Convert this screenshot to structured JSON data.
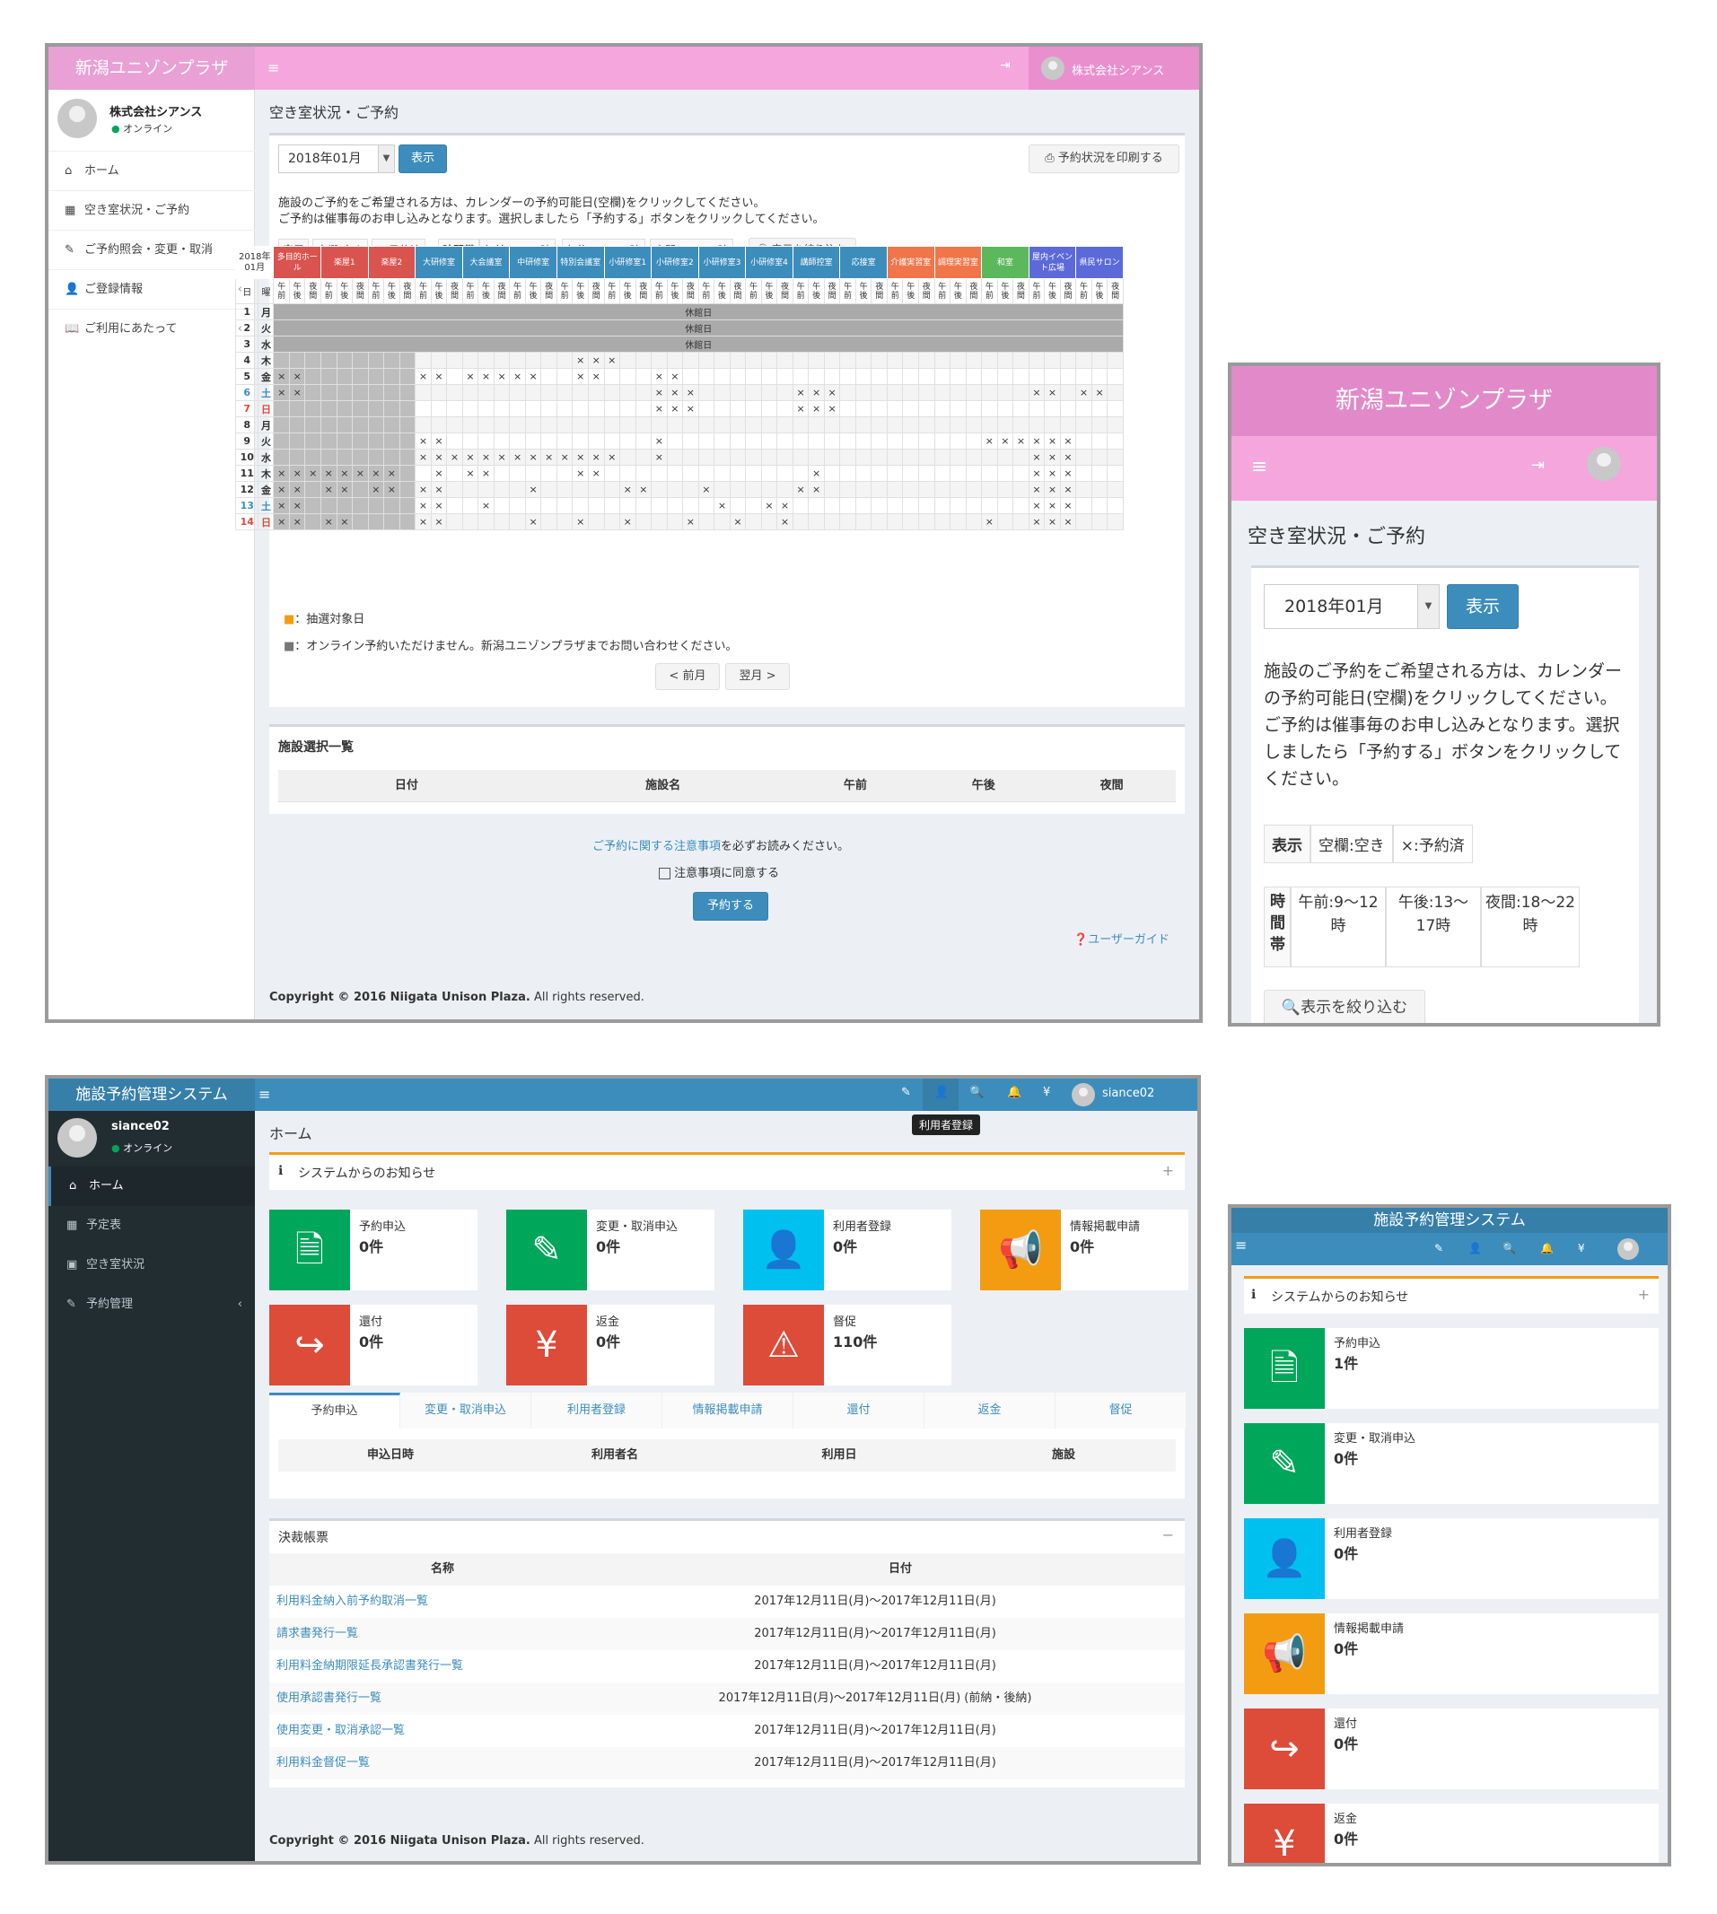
{
  "p1": {
    "logo": "新潟ユニゾンプラザ",
    "user": "株式会社シアンス",
    "status": "オンライン",
    "nav": [
      {
        "icon": "home-icon",
        "label": "ホーム"
      },
      {
        "icon": "calendar-icon",
        "label": "空き室状況・ご予約"
      },
      {
        "icon": "pencil-icon",
        "label": "ご予約照会・変更・取消"
      },
      {
        "icon": "user-icon",
        "label": "ご登録情報"
      },
      {
        "icon": "book-icon",
        "label": "ご利用にあたって"
      }
    ],
    "page_title": "空き室状況・ご予約",
    "month": "2018年01月",
    "show_btn": "表示",
    "print_btn": "予約状況を印刷する",
    "info1": "施設のご予約をご希望される方は、カレンダーの予約可能日(空欄)をクリックしてください。",
    "info2": "ご予約は催事毎のお申し込みとなります。選択しましたら「予約する」ボタンをクリックしてください。",
    "legend": {
      "show": "表示",
      "empty": "空欄:空き",
      "booked": "×:予約済",
      "time": "時間帯",
      "am": "午前:9〜12時",
      "pm": "午後:13〜17時",
      "night": "夜間:18〜22時",
      "filter": "表示を絞り込む"
    },
    "cal_corner": "2018年01月",
    "day_hdr": "日",
    "dow_hdr": "曜",
    "rooms": [
      {
        "name": "多目的ホール",
        "color": "#d9534f"
      },
      {
        "name": "楽屋1",
        "color": "#d9534f"
      },
      {
        "name": "楽屋2",
        "color": "#d9534f"
      },
      {
        "name": "大研修室",
        "color": "#3c8dbc"
      },
      {
        "name": "大会議室",
        "color": "#3c8dbc"
      },
      {
        "name": "中研修室",
        "color": "#3c8dbc"
      },
      {
        "name": "特別会議室",
        "color": "#3c8dbc"
      },
      {
        "name": "小研修室1",
        "color": "#3c8dbc"
      },
      {
        "name": "小研修室2",
        "color": "#3c8dbc"
      },
      {
        "name": "小研修室3",
        "color": "#3c8dbc"
      },
      {
        "name": "小研修室4",
        "color": "#3c8dbc"
      },
      {
        "name": "講師控室",
        "color": "#3c8dbc"
      },
      {
        "name": "応接室",
        "color": "#3c8dbc"
      },
      {
        "name": "介護実習室",
        "color": "#f0764a"
      },
      {
        "name": "調理実習室",
        "color": "#f0764a"
      },
      {
        "name": "和室",
        "color": "#5cb85c"
      },
      {
        "name": "屋内イベント広場",
        "color": "#5b6ad8"
      },
      {
        "name": "県民サロン",
        "color": "#5b6ad8"
      }
    ],
    "slots": [
      "午前",
      "午後",
      "夜間"
    ],
    "days": [
      {
        "d": "1",
        "w": "月",
        "closed": "休館日"
      },
      {
        "d": "2",
        "w": "火",
        "closed": "休館日"
      },
      {
        "d": "3",
        "w": "水",
        "closed": "休館日"
      },
      {
        "d": "4",
        "w": "木",
        "x": [
          19,
          20,
          21
        ]
      },
      {
        "d": "5",
        "w": "金",
        "x": [
          0,
          1,
          9,
          10,
          12,
          13,
          14,
          15,
          16,
          19,
          20,
          24,
          25
        ]
      },
      {
        "d": "6",
        "w": "土",
        "x": [
          0,
          1,
          24,
          25,
          26,
          33,
          34,
          35,
          48,
          49,
          51,
          52
        ],
        "c": "#3c8dbc"
      },
      {
        "d": "7",
        "w": "日",
        "x": [
          24,
          25,
          26,
          33,
          34,
          35
        ],
        "c": "#dd4b39"
      },
      {
        "d": "8",
        "w": "月",
        "x": []
      },
      {
        "d": "9",
        "w": "火",
        "x": [
          9,
          10,
          24,
          45,
          46,
          47,
          48,
          49,
          50
        ]
      },
      {
        "d": "10",
        "w": "水",
        "x": [
          9,
          10,
          11,
          12,
          13,
          14,
          15,
          16,
          17,
          18,
          19,
          20,
          21,
          24,
          48,
          49,
          50
        ]
      },
      {
        "d": "11",
        "w": "木",
        "x": [
          0,
          1,
          2,
          3,
          4,
          5,
          6,
          7,
          10,
          12,
          13,
          19,
          20,
          34,
          48,
          49,
          50
        ]
      },
      {
        "d": "12",
        "w": "金",
        "x": [
          0,
          1,
          3,
          4,
          6,
          7,
          9,
          10,
          16,
          22,
          23,
          27,
          33,
          34,
          48,
          49,
          50
        ]
      },
      {
        "d": "13",
        "w": "土",
        "x": [
          0,
          1,
          9,
          10,
          13,
          28,
          31,
          32,
          48,
          49,
          50
        ],
        "c": "#3c8dbc"
      },
      {
        "d": "14",
        "w": "日",
        "x": [
          0,
          1,
          3,
          4,
          9,
          10,
          16,
          19,
          22,
          26,
          29,
          32,
          45,
          48,
          49,
          50
        ],
        "c": "#dd4b39"
      }
    ],
    "note1": "：抽選対象日",
    "note2": "：オンライン予約いただけません。新潟ユニゾンプラザまでお問い合わせください。",
    "prev": "< 前月",
    "next": "翌月 >",
    "sel_title": "施設選択一覧",
    "sel_cols": [
      "日付",
      "施設名",
      "午前",
      "午後",
      "夜間"
    ],
    "notice_link": "ご予約に関する注意事項",
    "notice_rest": "を必ずお読みください。",
    "agree": "注意事項に同意する",
    "reserve": "予約する",
    "guide": "ユーザーガイド",
    "copyright_b": "Copyright © 2016 Niigata Unison Plaza.",
    "copyright": "All rights reserved."
  },
  "p2": {
    "logo": "新潟ユニゾンプラザ",
    "title": "空き室状況・ご予約",
    "month": "2018年01月",
    "show": "表示",
    "info": "施設のご予約をご希望される方は、カレンダーの予約可能日(空欄)をクリックしてください。ご予約は催事毎のお申し込みとなります。選択しましたら「予約する」ボタンをクリックしてください。",
    "lg_show": "表示",
    "lg_empty": "空欄:空き",
    "lg_booked": "×:予約済",
    "time": "時間帯",
    "am": "午前:9〜12時",
    "pm": "午後:13〜17時",
    "night": "夜間:18〜22時",
    "filter": "表示を絞り込む"
  },
  "p3": {
    "logo": "施設予約管理システム",
    "user": "siance02",
    "status": "オンライン",
    "tooltip": "利用者登録",
    "nav": [
      {
        "icon": "home-icon",
        "label": "ホーム"
      },
      {
        "icon": "table-icon",
        "label": "予定表"
      },
      {
        "icon": "calendar-icon",
        "label": "空き室状況"
      },
      {
        "icon": "pencil-icon",
        "label": "予約管理"
      }
    ],
    "page_title": "ホーム",
    "notice": "システムからのお知らせ",
    "boxes": [
      {
        "label": "予約申込",
        "count": "0件",
        "color": "#00a65a",
        "icon": "document-icon",
        "glyph": "🗎"
      },
      {
        "label": "変更・取消申込",
        "count": "0件",
        "color": "#00a65a",
        "icon": "edit-icon",
        "glyph": "✎"
      },
      {
        "label": "利用者登録",
        "count": "0件",
        "color": "#00c0ef",
        "icon": "user-icon",
        "glyph": "👤"
      },
      {
        "label": "情報掲載申請",
        "count": "0件",
        "color": "#f39c12",
        "icon": "megaphone-icon",
        "glyph": "📢"
      },
      {
        "label": "還付",
        "count": "0件",
        "color": "#dd4b39",
        "icon": "share-icon",
        "glyph": "↪"
      },
      {
        "label": "返金",
        "count": "0件",
        "color": "#dd4b39",
        "icon": "yen-icon",
        "glyph": "¥"
      },
      {
        "label": "督促",
        "count": "110件",
        "color": "#dd4b39",
        "icon": "warning-icon",
        "glyph": "⚠"
      }
    ],
    "tabs": [
      "予約申込",
      "変更・取消申込",
      "利用者登録",
      "情報掲載申請",
      "還付",
      "返金",
      "督促"
    ],
    "cols": [
      "申込日時",
      "利用者名",
      "利用日",
      "施設"
    ],
    "report_title": "決裁帳票",
    "report_cols": [
      "名称",
      "日付"
    ],
    "reports": [
      {
        "name": "利用料金納入前予約取消一覧",
        "date": "2017年12月11日(月)〜2017年12月11日(月)"
      },
      {
        "name": "請求書発行一覧",
        "date": "2017年12月11日(月)〜2017年12月11日(月)"
      },
      {
        "name": "利用料金納期限延長承認書発行一覧",
        "date": "2017年12月11日(月)〜2017年12月11日(月)"
      },
      {
        "name": "使用承認書発行一覧",
        "date": "2017年12月11日(月)〜2017年12月11日(月) (前納・後納)"
      },
      {
        "name": "使用変更・取消承認一覧",
        "date": "2017年12月11日(月)〜2017年12月11日(月)"
      },
      {
        "name": "利用料金督促一覧",
        "date": "2017年12月11日(月)〜2017年12月11日(月)"
      }
    ],
    "copyright_b": "Copyright © 2016 Niigata Unison Plaza.",
    "copyright": "All rights reserved."
  },
  "p4": {
    "logo": "施設予約管理システム",
    "notice": "システムからのお知らせ",
    "boxes": [
      {
        "label": "予約申込",
        "count": "1件",
        "color": "#00a65a",
        "icon": "document-icon",
        "glyph": "🗎"
      },
      {
        "label": "変更・取消申込",
        "count": "0件",
        "color": "#00a65a",
        "icon": "edit-icon",
        "glyph": "✎"
      },
      {
        "label": "利用者登録",
        "count": "0件",
        "color": "#00c0ef",
        "icon": "user-icon",
        "glyph": "👤"
      },
      {
        "label": "情報掲載申請",
        "count": "0件",
        "color": "#f39c12",
        "icon": "megaphone-icon",
        "glyph": "📢"
      },
      {
        "label": "還付",
        "count": "0件",
        "color": "#dd4b39",
        "icon": "share-icon",
        "glyph": "↪"
      },
      {
        "label": "返金",
        "count": "0件",
        "color": "#dd4b39",
        "icon": "yen-icon",
        "glyph": "¥"
      }
    ]
  }
}
